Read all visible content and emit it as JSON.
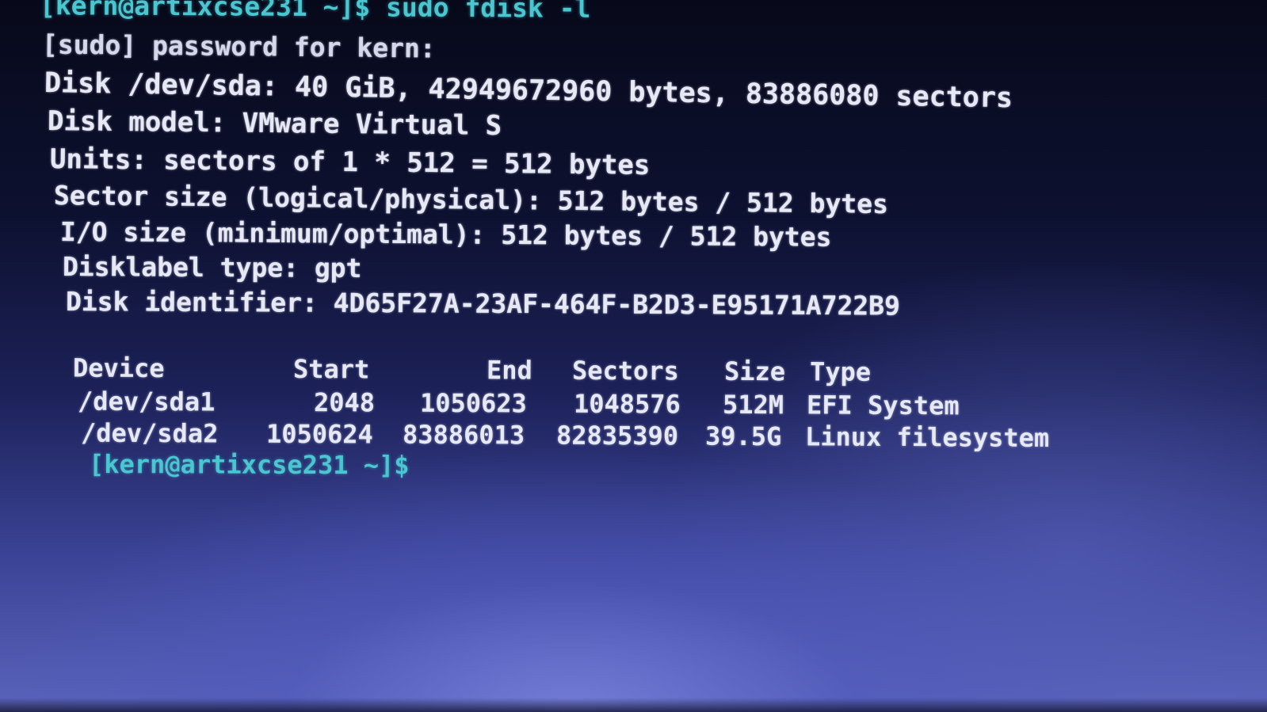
{
  "terminal": {
    "lines": {
      "cmd": "[kern@artixcse231 ~]$ sudo fdisk -l",
      "sudo": "[sudo] password for kern:",
      "disk": "Disk /dev/sda: 40 GiB, 42949672960 bytes, 83886080 sectors",
      "model": "Disk model: VMware Virtual S",
      "units": "Units: sectors of 1 * 512 = 512 bytes",
      "sector_size": "Sector size (logical/physical): 512 bytes / 512 bytes",
      "io_size": "I/O size (minimum/optimal): 512 bytes / 512 bytes",
      "disklabel": "Disklabel type: gpt",
      "identifier": "Disk identifier: 4D65F27A-23AF-464F-B2D3-E95171A722B9"
    },
    "table": {
      "headers": {
        "device": "Device",
        "start": "Start",
        "end": "End",
        "sectors": "Sectors",
        "size": "Size",
        "type": "Type"
      },
      "rows": [
        {
          "device": "/dev/sda1",
          "start": "2048",
          "end": "1050623",
          "sectors": "1048576",
          "size": "512M",
          "type": "EFI System"
        },
        {
          "device": "/dev/sda2",
          "start": "1050624",
          "end": "83886013",
          "sectors": "82835390",
          "size": "39.5G",
          "type": "Linux filesystem"
        }
      ]
    },
    "final_prompt": "[kern@artixcse231 ~]$"
  },
  "colors": {
    "prompt": "#49c6cf",
    "text": "#e6e8f4",
    "background": "#0d1130"
  }
}
